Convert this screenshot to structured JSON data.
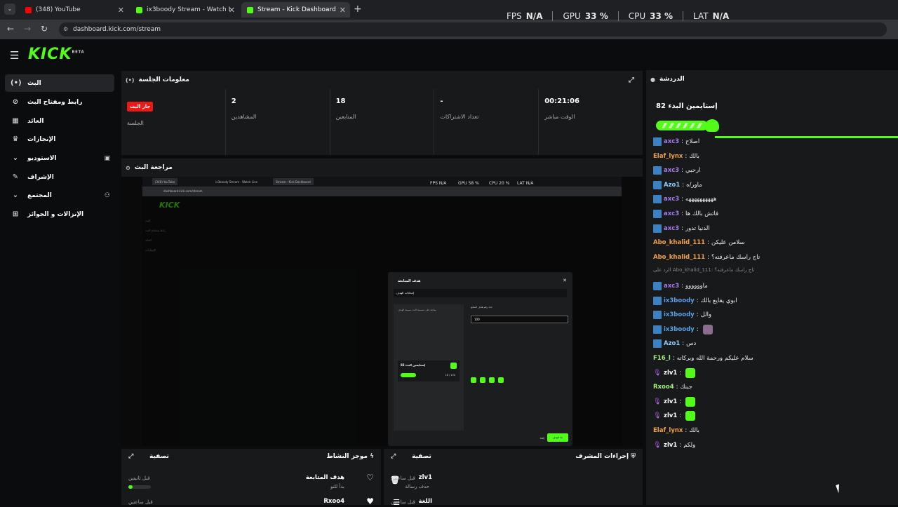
{
  "browser": {
    "tabs": [
      {
        "title": "(348) YouTube",
        "color": "#ff0000"
      },
      {
        "title": "ix3boody Stream - Watch Live o",
        "color": "#53fc18"
      },
      {
        "title": "Stream - Kick Dashboard",
        "color": "#53fc18"
      }
    ],
    "url": "dashboard.kick.com/stream"
  },
  "overlay": {
    "fps_label": "FPS",
    "fps_value": "N/A",
    "gpu_label": "GPU",
    "gpu_value": "33 %",
    "cpu_label": "CPU",
    "cpu_value": "33 %",
    "lat_label": "LAT",
    "lat_value": "N/A"
  },
  "brand": {
    "logo": "KICK",
    "beta": "BETA",
    "accent": "#53fc18"
  },
  "sidebar": {
    "items": [
      {
        "label": "البث",
        "icon": "broadcast-icon"
      },
      {
        "label": "رابط ومفتاح البث",
        "icon": "link-icon"
      },
      {
        "label": "العائد",
        "icon": "revenue-icon"
      },
      {
        "label": "الإنجازات",
        "icon": "trophy-icon"
      },
      {
        "label": "الاستوديو",
        "icon": "chevron-down-icon"
      },
      {
        "label": "الإشراف",
        "icon": "wrench-icon"
      },
      {
        "label": "المجتمع",
        "icon": "chevron-down-icon"
      },
      {
        "label": "الإنزالات و الجوائز",
        "icon": "gift-icon"
      }
    ]
  },
  "session": {
    "title": "معلومات الجلسة",
    "live_badge": "جار البث",
    "session_label": "الجلسة",
    "viewers_value": "2",
    "viewers_label": "المشاهدين",
    "followers_value": "18",
    "followers_label": "المتابعين",
    "subs_value": "-",
    "subs_label": "تعداد الاشتراكات",
    "time_value": "00:21:06",
    "time_label": "الوقت مباشر"
  },
  "preview": {
    "title": "مراجعة البث",
    "nested_fps": "FPS N/A",
    "nested_gpu": "GPU 58 %",
    "nested_cpu": "CPU 20 %",
    "nested_lat": "LAT N/A",
    "modal_title": "هدف المتابعة",
    "modal_tab": "إعدادات الهدف",
    "modal_left_hint": "معاينة على مسمية البث بسمية الهدف",
    "modal_goal_label": "حدد رقم هدف المتابع",
    "modal_input_value": "100",
    "modal_card_title": "إستايمين البدء 82",
    "modal_card_count": "18 / 100",
    "modal_start": "بدء الهدف",
    "modal_cancel": "إلغاء"
  },
  "chat": {
    "title": "الدردشة",
    "goal_title": "إستايمين البدء 82",
    "messages": [
      {
        "user": "axc3",
        "text": "اصلاح",
        "color": "#a67bf0",
        "badge": "verified-icon"
      },
      {
        "user": "Elaf_lynx",
        "text": "بالك",
        "color": "#f0a048",
        "badge": ""
      },
      {
        "user": "axc3",
        "text": "ارحبي",
        "color": "#a67bf0",
        "badge": "verified-icon"
      },
      {
        "user": "Azo1",
        "text": "ماور/ه",
        "color": "#8ecbf5",
        "badge": "verified-icon"
      },
      {
        "user": "axc3",
        "text": "ههههههههههه",
        "color": "#a67bf0",
        "badge": "verified-icon"
      },
      {
        "user": "axc3",
        "text": "فاتش بالك ها",
        "color": "#a67bf0",
        "badge": "verified-icon"
      },
      {
        "user": "axc3",
        "text": "الدنيا تدور",
        "color": "#a67bf0",
        "badge": "verified-icon"
      },
      {
        "user": "Abo_khalid_111",
        "text": "سلامن عليكن",
        "color": "#f0a048",
        "badge": ""
      },
      {
        "user": "Abo_khalid_111",
        "text": "تاج راسك ماعرفته؟",
        "color": "#f0a048",
        "badge": ""
      },
      {
        "user": "",
        "text": "الرد على Abo_khalid_111: تاج راسك ماعرفته؟",
        "color": "#888888",
        "badge": "reply"
      },
      {
        "user": "axc3",
        "text": "ماوووووو",
        "color": "#a67bf0",
        "badge": "verified-icon"
      },
      {
        "user": "ix3boody",
        "text": "ابوي يقايع بالك",
        "color": "#5aa0e8",
        "badge": "verified-icon"
      },
      {
        "user": "ix3boody",
        "text": "والل",
        "color": "#5aa0e8",
        "badge": "verified-icon"
      },
      {
        "user": "ix3boody",
        "text": "",
        "color": "#5aa0e8",
        "badge": "verified-icon"
      },
      {
        "user": "Azo1",
        "text": "دس",
        "color": "#8ecbf5",
        "badge": "verified-icon"
      },
      {
        "user": "F16_l",
        "text": "سلام عليكم ورحمة الله وبركاته",
        "color": "#9ef07a",
        "badge": ""
      },
      {
        "user": "zlv1",
        "text": "",
        "color": "#ffffff",
        "badge": "mic"
      },
      {
        "user": "Rxoo4",
        "text": "جبنك",
        "color": "#9ef07a",
        "badge": ""
      },
      {
        "user": "zlv1",
        "text": "",
        "color": "#ffffff",
        "badge": "mic"
      },
      {
        "user": "zlv1",
        "text": "",
        "color": "#ffffff",
        "badge": "mic"
      },
      {
        "user": "Elaf_lynx",
        "text": "بالك",
        "color": "#f0a048",
        "badge": ""
      },
      {
        "user": "zlv1",
        "text": "ولكم",
        "color": "#ffffff",
        "badge": "mic"
      }
    ]
  },
  "activity": {
    "title": "موجز النشاط",
    "filter": "تصفية",
    "item1_title": "هدف المتابعة",
    "item1_sub": "بدأ للتو",
    "item1_time": "قبل ثانيتين",
    "item2_title": "Rxoo4",
    "item2_time": "قبل ساعتين"
  },
  "mod": {
    "title": "إجراءات المشرف",
    "filter": "تصفية",
    "item1_title": "zlv1",
    "item1_sub": "حذف رسالة",
    "item1_time": "قبل ساعتين",
    "item2_title": "اللغة",
    "item2_time": "قبل ساعتين"
  }
}
